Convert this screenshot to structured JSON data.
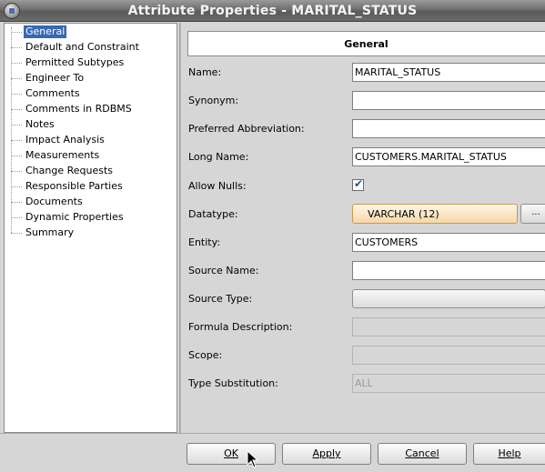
{
  "window": {
    "title": "Attribute Properties - MARITAL_STATUS"
  },
  "tree": {
    "items": [
      {
        "label": "General",
        "selected": true
      },
      {
        "label": "Default and Constraint"
      },
      {
        "label": "Permitted Subtypes"
      },
      {
        "label": "Engineer To"
      },
      {
        "label": "Comments"
      },
      {
        "label": "Comments in RDBMS"
      },
      {
        "label": "Notes"
      },
      {
        "label": "Impact Analysis"
      },
      {
        "label": "Measurements"
      },
      {
        "label": "Change Requests"
      },
      {
        "label": "Responsible Parties"
      },
      {
        "label": "Documents"
      },
      {
        "label": "Dynamic Properties"
      },
      {
        "label": "Summary"
      }
    ]
  },
  "form": {
    "header": "General",
    "fields": {
      "name": {
        "label": "Name:",
        "value": "MARITAL_STATUS"
      },
      "synonym": {
        "label": "Synonym:",
        "value": ""
      },
      "preferred_abbreviation": {
        "label": "Preferred Abbreviation:",
        "value": ""
      },
      "long_name": {
        "label": "Long Name:",
        "value": "CUSTOMERS.MARITAL_STATUS"
      },
      "allow_nulls": {
        "label": "Allow Nulls:",
        "checked": true,
        "mark": "✔"
      },
      "datatype": {
        "label": "Datatype:",
        "value": "VARCHAR (12)",
        "button": "..."
      },
      "entity": {
        "label": "Entity:",
        "value": "CUSTOMERS"
      },
      "source_name": {
        "label": "Source Name:",
        "value": ""
      },
      "source_type": {
        "label": "Source Type:",
        "value": ""
      },
      "formula_description": {
        "label": "Formula Description:",
        "value": ""
      },
      "scope": {
        "label": "Scope:",
        "value": ""
      },
      "type_substitution": {
        "label": "Type Substitution:",
        "value": "ALL"
      }
    }
  },
  "buttons": {
    "ok": "OK",
    "apply": "Apply",
    "cancel": "Cancel",
    "help": "Help"
  },
  "icons": {
    "app": "app-globe-icon",
    "cursor": "mouse-pointer-icon"
  }
}
